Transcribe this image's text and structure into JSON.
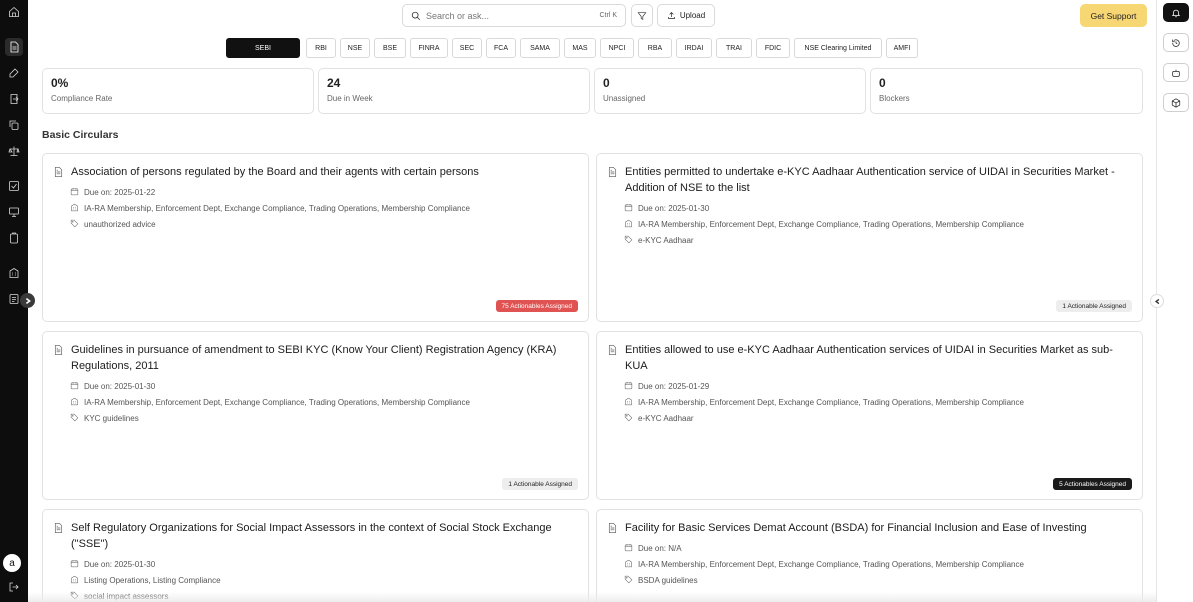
{
  "sidebar": {
    "avatar_letter": "a"
  },
  "topbar": {
    "search_placeholder": "Search or ask...",
    "search_shortcut": "Ctrl K",
    "upload_label": "Upload",
    "support_label": "Get Support"
  },
  "regulators": [
    {
      "label": "SEBI",
      "active": true
    },
    {
      "label": "RBI"
    },
    {
      "label": "NSE"
    },
    {
      "label": "BSE"
    },
    {
      "label": "FINRA"
    },
    {
      "label": "SEC"
    },
    {
      "label": "FCA"
    },
    {
      "label": "SAMA"
    },
    {
      "label": "MAS"
    },
    {
      "label": "NPCI"
    },
    {
      "label": "RBA"
    },
    {
      "label": "IRDAI"
    },
    {
      "label": "TRAI"
    },
    {
      "label": "FDIC"
    },
    {
      "label": "NSE Clearing Limited"
    },
    {
      "label": "AMFI"
    }
  ],
  "stats": [
    {
      "value": "0%",
      "label": "Compliance Rate"
    },
    {
      "value": "24",
      "label": "Due in Week"
    },
    {
      "value": "0",
      "label": "Unassigned"
    },
    {
      "value": "0",
      "label": "Blockers"
    }
  ],
  "section_title": "Basic Circulars",
  "circulars": [
    {
      "title": "Association of persons regulated by the Board and their agents with certain persons",
      "due": "Due on: 2025-01-22",
      "depts": "IA-RA Membership, Enforcement Dept, Exchange Compliance, Trading Operations, Membership Compliance",
      "tag": "unauthorized advice",
      "badge": "75 Actionables Assigned",
      "badge_color": "#e05353"
    },
    {
      "title": "Entities permitted to undertake e-KYC Aadhaar Authentication service of UIDAI in Securities Market - Addition of NSE to the list",
      "due": "Due on: 2025-01-30",
      "depts": "IA-RA Membership, Enforcement Dept, Exchange Compliance, Trading Operations, Membership Compliance",
      "tag": "e-KYC Aadhaar",
      "badge": "1 Actionable Assigned",
      "badge_color": "#ededed"
    },
    {
      "title": "Guidelines in pursuance of amendment to SEBI KYC (Know Your Client) Registration Agency (KRA) Regulations, 2011",
      "due": "Due on: 2025-01-30",
      "depts": "IA-RA Membership, Enforcement Dept, Exchange Compliance, Trading Operations, Membership Compliance",
      "tag": "KYC guidelines",
      "badge": "1 Actionable Assigned",
      "badge_color": "#ededed"
    },
    {
      "title": "Entities allowed to use e-KYC Aadhaar Authentication services of UIDAI in Securities Market as sub-KUA",
      "due": "Due on: 2025-01-29",
      "depts": "IA-RA Membership, Enforcement Dept, Exchange Compliance, Trading Operations, Membership Compliance",
      "tag": "e-KYC Aadhaar",
      "badge": "5 Actionables Assigned",
      "badge_color": "#1a1a1a"
    },
    {
      "title": "Self Regulatory Organizations for Social Impact Assessors in the context of Social Stock Exchange (\"SSE\")",
      "due": "Due on: 2025-01-30",
      "depts": "Listing Operations, Listing Compliance",
      "tag": "social impact assessors"
    },
    {
      "title": "Facility for Basic Services Demat Account (BSDA) for Financial Inclusion and Ease of Investing",
      "due": "Due on: N/A",
      "depts": "IA-RA Membership, Enforcement Dept, Exchange Compliance, Trading Operations, Membership Compliance",
      "tag": "BSDA guidelines"
    }
  ]
}
